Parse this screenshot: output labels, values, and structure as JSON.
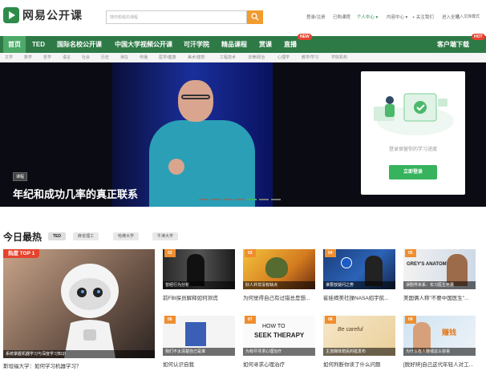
{
  "header": {
    "logo_text": "网易公开课",
    "search_placeholder": "搜你想看的课程",
    "links": [
      "登录/注册",
      "已购课程",
      "个人中心 ▾",
      "内容中心 ▾",
      "+ 关注我们",
      "进入全站",
      "进入文库模式"
    ]
  },
  "nav": {
    "items": [
      "首页",
      "TED",
      "国际名校公开课",
      "中国大学视频公开课",
      "可汗学院",
      "精品课程",
      "赏课",
      "直播",
      "客户端下载"
    ],
    "badges": {
      "live": "NEW",
      "download": "HOT"
    },
    "sub_items": [
      "文学",
      "数学",
      "哲学",
      "语言",
      "社会",
      "历史",
      "演在",
      "传播",
      "医学/健康",
      "美术/建筑",
      "工程技术",
      "法律/政治",
      "心理学",
      "教学/学习",
      "学院机构"
    ]
  },
  "hero": {
    "tag": "课程",
    "title": "年纪和成功几率的真正联系",
    "slide_count": 7,
    "active_slide": 5
  },
  "login_card": {
    "prompt": "登录保留你的学习进度",
    "button": "立即登录"
  },
  "hot": {
    "title": "今日最热",
    "tags": [
      "TED",
      "麻省理工",
      "哈佛大学",
      "牛津大学"
    ],
    "featured": {
      "label": "热度 TOP 1",
      "caption": "系统掌握机器学习与深度学习知识",
      "title": "斯坦福大学：如何学习机器学习？"
    },
    "cards": [
      {
        "num": "02",
        "caption": "曾经行为分析",
        "title": "前FBI探员解释如何测谎"
      },
      {
        "num": "03",
        "caption": "好人并非没有缺点",
        "title": "为何觉得自己有过错总是想..."
      },
      {
        "num": "04",
        "caption": "谁要放疑问之势",
        "title": "崔娃揭美社操NASA招宇航..."
      },
      {
        "num": "05",
        "caption": "误剧界未系：实习医生格蕾",
        "title": "美国俩人称\"不要中国医生\"..."
      },
      {
        "num": "06",
        "caption": "我们不太清楚自己是谁",
        "title": "如何认识自我"
      },
      {
        "num": "07",
        "caption": "为有尽寻求心理治疗",
        "title": "如何寻求心理治疗"
      },
      {
        "num": "08",
        "caption": "主流媒体若民的挺发布",
        "title": "如何判断你读了什么问题"
      },
      {
        "num": "09",
        "caption": "为什么有人赚钱这么容易",
        "title": "[脱好辨]自己这代年轻人对工..."
      }
    ]
  },
  "colors": {
    "nav_green": "#2e7a47",
    "accent_orange": "#f29b2f",
    "login_green": "#36b35c",
    "hot_red": "#e5432e"
  }
}
